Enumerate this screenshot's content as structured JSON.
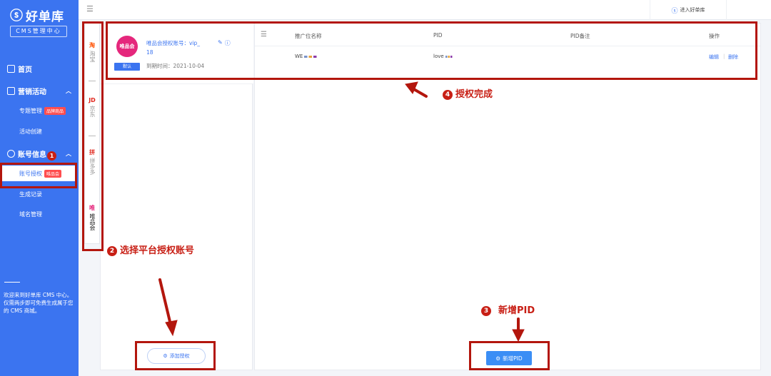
{
  "sidebar": {
    "logo_mark": "ⓢ",
    "logo_text": "好单库",
    "logo_sub": "CMS管理中心",
    "nav": {
      "home": "首页",
      "marketing": "营销活动",
      "topic_mgmt": "专题管理",
      "topic_badge": "品牌商品",
      "activity_create": "活动创建",
      "account_info": "账号信息",
      "account_auth": "账号授权",
      "account_badge": "唯品会",
      "gen_records": "生成记录",
      "domain_mgmt": "域名管理"
    },
    "footer": "欢迎来到好单库 CMS 中心。仅需两步即可免费生成属于您的 CMS 商城。"
  },
  "topbar": {
    "collapse_icon": "hamburger-icon",
    "enter_label": "进入好单库"
  },
  "platforms": [
    {
      "logo": "淘",
      "label": "淘宝"
    },
    {
      "logo": "JD",
      "label": "京东"
    },
    {
      "logo": "拼",
      "label": "拼多多"
    },
    {
      "logo": "唯",
      "label": "唯品会"
    }
  ],
  "account": {
    "logo_text": "唯品会",
    "default_tag": "默认",
    "name": "唯品会授权账号：vip_",
    "number": "18",
    "expire": "到期时间：2021-10-04",
    "add_button": "添加授权"
  },
  "table": {
    "headers": [
      "推广位名称",
      "PID",
      "PID备注",
      "操作"
    ],
    "rows": [
      {
        "name": "WE",
        "pid": "love",
        "remark": "",
        "edit": "编辑",
        "sep": "|",
        "delete": "删除"
      }
    ],
    "new_button": "新增PID"
  },
  "annotations": {
    "n1": "1",
    "n2": "2",
    "t2": "选择平台授权账号",
    "n3": "3",
    "t3": "新增PID",
    "n4": "4",
    "t4": "授权完成"
  },
  "colors": {
    "primary": "#3b74f0",
    "annotation": "#b3160d",
    "vip": "#e5277c"
  }
}
